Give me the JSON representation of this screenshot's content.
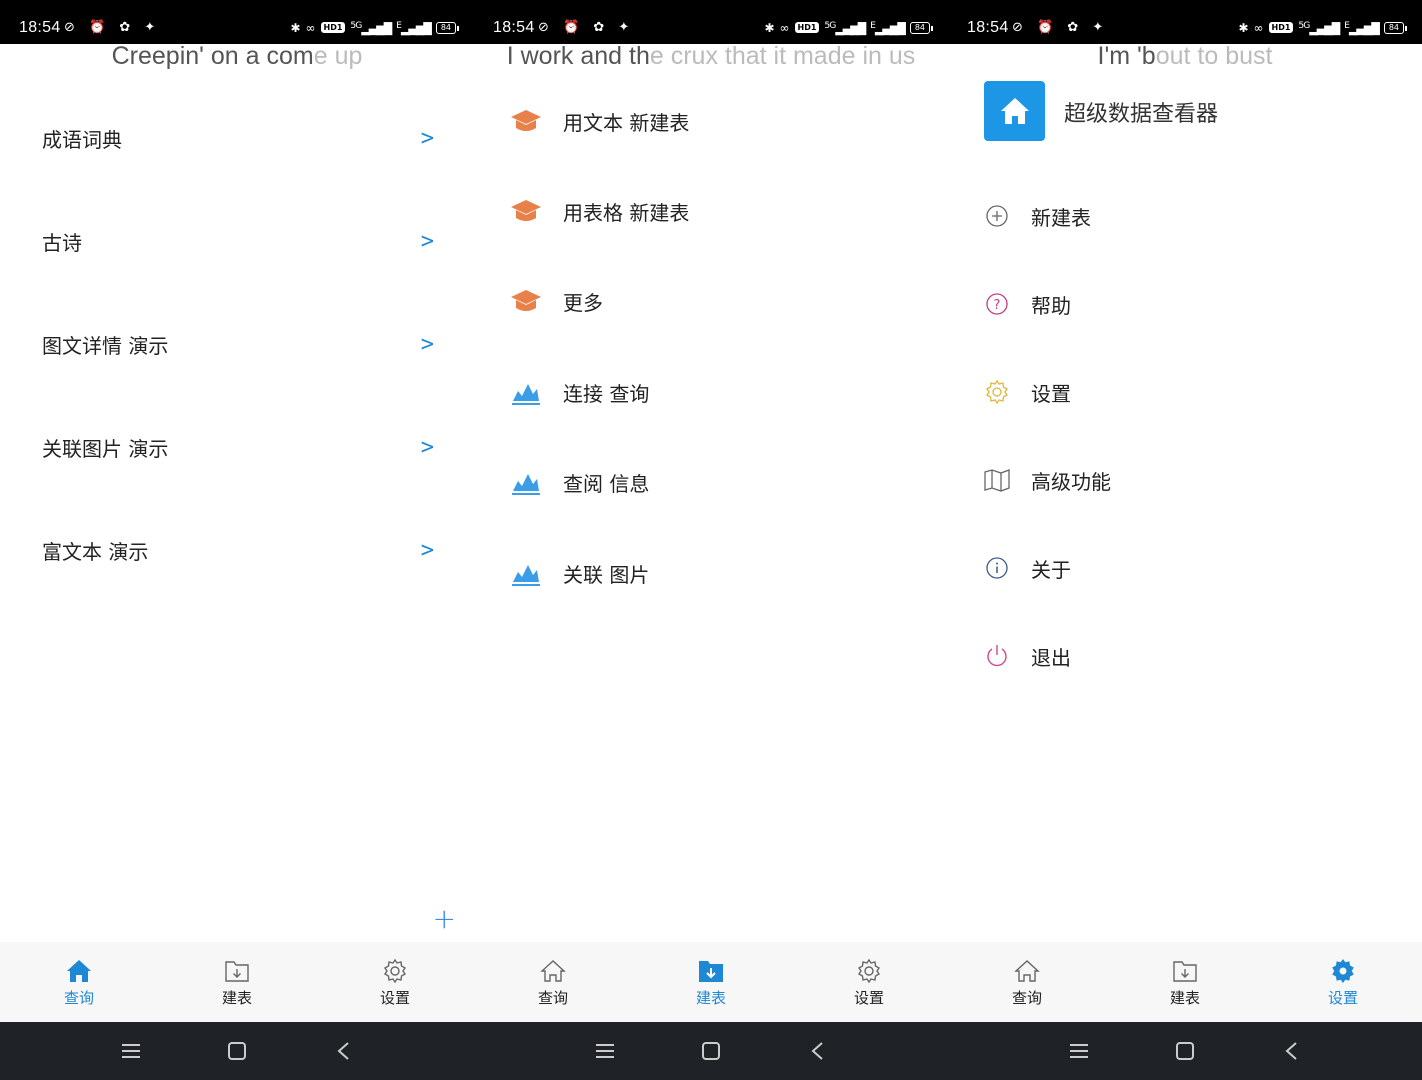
{
  "status": {
    "time": "18:54",
    "battery": "84",
    "hd_badge": "HD1",
    "network_sig": "5G",
    "network_e": "E"
  },
  "colors": {
    "accent": "#1e88d4",
    "orange": "#e8804a",
    "blue_chart": "#3b9ce8"
  },
  "tabs": [
    {
      "label": "查询",
      "icon": "home-icon"
    },
    {
      "label": "建表",
      "icon": "folder-download-icon"
    },
    {
      "label": "设置",
      "icon": "gear-icon"
    }
  ],
  "panel1": {
    "lyric_on": "Creepin' on a com",
    "lyric_off": "e up",
    "items": [
      {
        "label": "成语词典"
      },
      {
        "label": "古诗"
      },
      {
        "label": "图文详情 演示"
      },
      {
        "label": "关联图片 演示"
      },
      {
        "label": "富文本 演示"
      }
    ],
    "chevron": ">",
    "fab": "+"
  },
  "panel2": {
    "lyric_on": "I work and th",
    "lyric_off": "e crux that it made in us",
    "items": [
      {
        "label": "用文本 新建表",
        "icon": "graduation-cap-icon"
      },
      {
        "label": "用表格 新建表",
        "icon": "graduation-cap-icon"
      },
      {
        "label": "更多",
        "icon": "graduation-cap-icon"
      },
      {
        "label": "连接 查询",
        "icon": "area-chart-icon"
      },
      {
        "label": "查阅 信息",
        "icon": "area-chart-icon"
      },
      {
        "label": "关联 图片",
        "icon": "area-chart-icon"
      }
    ]
  },
  "panel3": {
    "lyric_on": "I'm 'b",
    "lyric_off": "out to bust",
    "app_title": "超级数据查看器",
    "items": [
      {
        "label": "新建表",
        "icon": "plus-circle-icon"
      },
      {
        "label": "帮助",
        "icon": "help-circle-icon"
      },
      {
        "label": "设置",
        "icon": "gear-icon"
      },
      {
        "label": "高级功能",
        "icon": "map-icon"
      },
      {
        "label": "关于",
        "icon": "info-circle-icon"
      },
      {
        "label": "退出",
        "icon": "power-icon"
      }
    ]
  }
}
